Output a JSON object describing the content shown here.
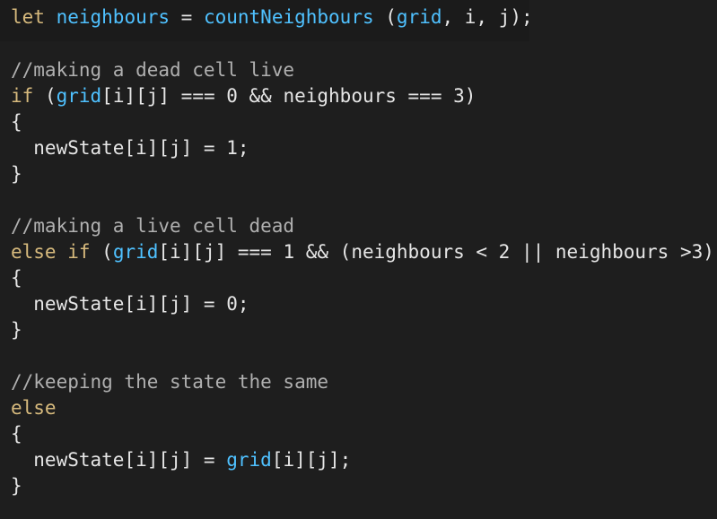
{
  "editor": {
    "lines": [
      {
        "tokens": [
          {
            "t": "kw",
            "s": "let"
          },
          {
            "t": "tx",
            "s": " "
          },
          {
            "t": "id",
            "s": "neighbours"
          },
          {
            "t": "tx",
            "s": " = "
          },
          {
            "t": "fn",
            "s": "countNeighbours"
          },
          {
            "t": "tx",
            "s": " ("
          },
          {
            "t": "id",
            "s": "grid"
          },
          {
            "t": "tx",
            "s": ", i, j);"
          }
        ]
      },
      {
        "tokens": [
          {
            "t": "cm",
            "s": "//making a dead cell live"
          }
        ]
      },
      {
        "tokens": [
          {
            "t": "kw",
            "s": "if"
          },
          {
            "t": "tx",
            "s": " ("
          },
          {
            "t": "id",
            "s": "grid"
          },
          {
            "t": "tx",
            "s": "[i][j] === 0 && neighbours === 3)"
          }
        ]
      },
      {
        "tokens": [
          {
            "t": "tx",
            "s": "{"
          }
        ]
      },
      {
        "tokens": [
          {
            "t": "tx",
            "s": "  newState[i][j] = 1;"
          }
        ]
      },
      {
        "tokens": [
          {
            "t": "tx",
            "s": "}"
          }
        ]
      },
      {
        "tokens": [
          {
            "t": "cm",
            "s": "//making a live cell dead"
          }
        ]
      },
      {
        "tokens": [
          {
            "t": "kw",
            "s": "else if"
          },
          {
            "t": "tx",
            "s": " ("
          },
          {
            "t": "id",
            "s": "grid"
          },
          {
            "t": "tx",
            "s": "[i][j] === 1 && (neighbours < 2 || neighbours >3))"
          }
        ]
      },
      {
        "tokens": [
          {
            "t": "tx",
            "s": "{"
          }
        ]
      },
      {
        "tokens": [
          {
            "t": "tx",
            "s": "  newState[i][j] = 0;"
          }
        ]
      },
      {
        "tokens": [
          {
            "t": "tx",
            "s": "}"
          }
        ]
      },
      {
        "tokens": [
          {
            "t": "cm",
            "s": "//keeping the state the same"
          }
        ]
      },
      {
        "tokens": [
          {
            "t": "kw",
            "s": "else"
          }
        ]
      },
      {
        "tokens": [
          {
            "t": "tx",
            "s": "{"
          }
        ]
      },
      {
        "tokens": [
          {
            "t": "tx",
            "s": "  newState[i][j] = "
          },
          {
            "t": "id",
            "s": "grid"
          },
          {
            "t": "tx",
            "s": "[i][j];"
          }
        ]
      },
      {
        "tokens": [
          {
            "t": "tx",
            "s": "}"
          }
        ]
      }
    ]
  },
  "colors": {
    "background": "#1e1e1e",
    "keyword": "#d7ba7d",
    "identifier": "#4fc1ff",
    "comment": "#b0b0b0",
    "text": "#e6e6e6"
  }
}
